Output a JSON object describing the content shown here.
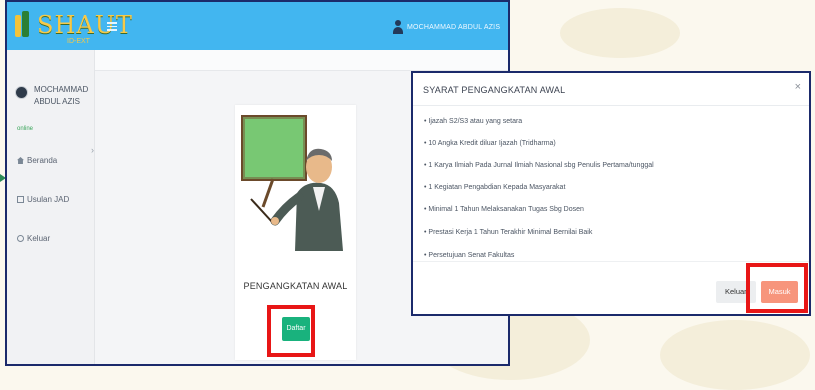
{
  "app": {
    "logo_text": "SHAUT",
    "logo_sub": "ID-EXT",
    "user_name": "MOCHAMMAD ABDUL AZIS"
  },
  "sidebar": {
    "user_name": "MOCHAMMAD ABDUL AZIS",
    "status": "online",
    "items": [
      {
        "label": "Beranda",
        "icon": "home-icon"
      },
      {
        "label": "Usulan JAD",
        "icon": "document-icon"
      },
      {
        "label": "Keluar",
        "icon": "logout-icon"
      }
    ]
  },
  "card": {
    "title": "PENGANGKATAN AWAL",
    "button_label": "Daftar"
  },
  "modal": {
    "title": "SYARAT PENGANGKATAN AWAL",
    "close_label": "×",
    "requirements": [
      "• Ijazah S2/S3 atau yang setara",
      "• 10 Angka Kredit diluar Ijazah (Tridharma)",
      "• 1 Karya Ilmiah Pada Jurnal Ilmiah Nasional sbg Penulis Pertama/tunggal",
      "• 1 Kegiatan Pengabdian Kepada Masyarakat",
      "• Minimal 1 Tahun Melaksanakan Tugas Sbg Dosen",
      "• Prestasi Kerja 1 Tahun Terakhir Minimal Bernilai Baik",
      "• Persetujuan Senat Fakultas"
    ],
    "keluar_label": "Keluar",
    "masuk_label": "Masuk"
  },
  "colors": {
    "topbar": "#42b6f0",
    "daftar_button": "#19b27d",
    "masuk_button": "#f7957c",
    "highlight": "#e81616"
  }
}
